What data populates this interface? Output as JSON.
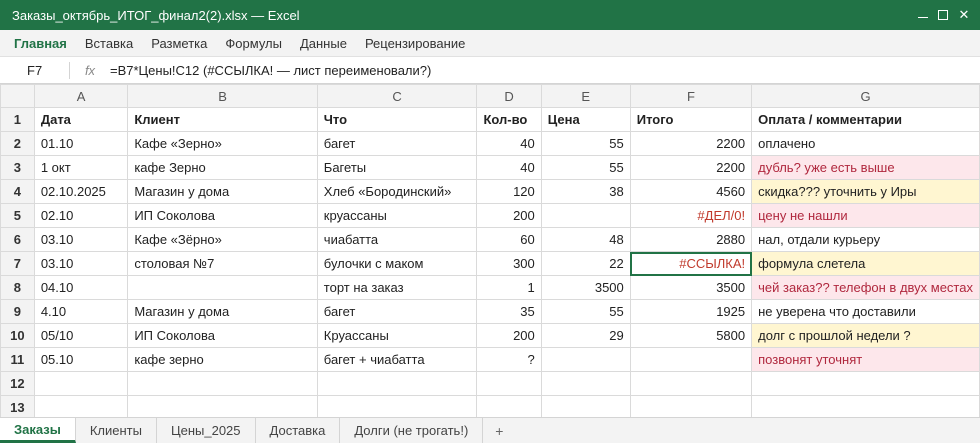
{
  "window": {
    "title": "Заказы_октябрь_ИТОГ_финал2(2).xlsx — Excel",
    "controls": [
      {
        "name": "minimize-icon",
        "glyph": ""
      },
      {
        "name": "maximize-icon",
        "glyph": ""
      },
      {
        "name": "close-icon",
        "glyph": "✕"
      }
    ]
  },
  "ribbon": {
    "tabs": [
      "Главная",
      "Вставка",
      "Разметка",
      "Формулы",
      "Данные",
      "Рецензирование"
    ],
    "active_index": 0
  },
  "formula_bar": {
    "name_box": "F7",
    "fx_label": "fx",
    "formula": "=B7*Цены!C12 (#ССЫЛКА! — лист переименовали?)"
  },
  "grid": {
    "columns": [
      "A",
      "B",
      "C",
      "D",
      "E",
      "F",
      "G"
    ],
    "selected_cell": "F7",
    "rows": [
      {
        "n": "1",
        "cells": [
          "Дата",
          "Клиент",
          "Что",
          "Кол-во",
          "Цена",
          "Итого",
          "Оплата / комментарии"
        ],
        "header": true
      },
      {
        "n": "2",
        "cells": [
          "01.10",
          "Кафе «Зерно»",
          "багет",
          "40",
          "55",
          "2200",
          "оплачено"
        ],
        "g_style": ""
      },
      {
        "n": "3",
        "cells": [
          "1 окт",
          "кафе Зерно",
          "Багеты",
          "40",
          "55",
          "2200",
          "дубль? уже есть выше"
        ],
        "g_style": "pink"
      },
      {
        "n": "4",
        "cells": [
          "02.10.2025",
          "Магазин у дома",
          "Хлеб «Бородинский»",
          "120",
          "38",
          "4560",
          "скидка??? уточнить у Иры"
        ],
        "g_style": "yellow"
      },
      {
        "n": "5",
        "cells": [
          "02.10",
          "ИП Соколова",
          "круассаны",
          "200",
          "",
          "#ДЕЛ/0!",
          "цену не нашли"
        ],
        "g_style": "pink",
        "f_error": true
      },
      {
        "n": "6",
        "cells": [
          "03.10",
          "Кафе «Зёрно»",
          "чиабатта",
          "60",
          "48",
          "2880",
          "нал, отдали курьеру"
        ],
        "g_style": ""
      },
      {
        "n": "7",
        "cells": [
          "03.10",
          "столовая №7",
          "булочки с маком",
          "300",
          "22",
          "#ССЫЛКА!",
          "формула слетела"
        ],
        "g_style": "yellow",
        "f_error": true
      },
      {
        "n": "8",
        "cells": [
          "04.10",
          "",
          "торт на заказ",
          "1",
          "3500",
          "3500",
          "чей заказ?? телефон в двух местах"
        ],
        "g_style": "pink"
      },
      {
        "n": "9",
        "cells": [
          "4.10",
          "Магазин у дома",
          "багет",
          "35",
          "55",
          "1925",
          "не уверена что доставили"
        ],
        "g_style": ""
      },
      {
        "n": "10",
        "cells": [
          "05/10",
          "ИП Соколова",
          "Круассаны",
          "200",
          "29",
          "5800",
          "долг с прошлой недели ?"
        ],
        "g_style": "yellow"
      },
      {
        "n": "11",
        "cells": [
          "05.10",
          "кафе зерно",
          "багет + чиабатта",
          "?",
          "",
          "",
          "позвонят уточнят"
        ],
        "g_style": "pink"
      },
      {
        "n": "12",
        "cells": [
          "",
          "",
          "",
          "",
          "",
          "",
          ""
        ],
        "g_style": ""
      },
      {
        "n": "13",
        "cells": [
          "",
          "",
          "",
          "",
          "",
          "",
          ""
        ],
        "g_style": ""
      }
    ]
  },
  "sheet_tabs": {
    "tabs": [
      "Заказы",
      "Клиенты",
      "Цены_2025",
      "Доставка",
      "Долги (не трогать!)"
    ],
    "active_index": 0,
    "add_label": "+"
  },
  "colors": {
    "brand": "#217346",
    "pink_bg": "#fde7eb",
    "pink_text": "#b0283e",
    "yellow_bg": "#fff6d1",
    "error_text": "#c0392b"
  }
}
